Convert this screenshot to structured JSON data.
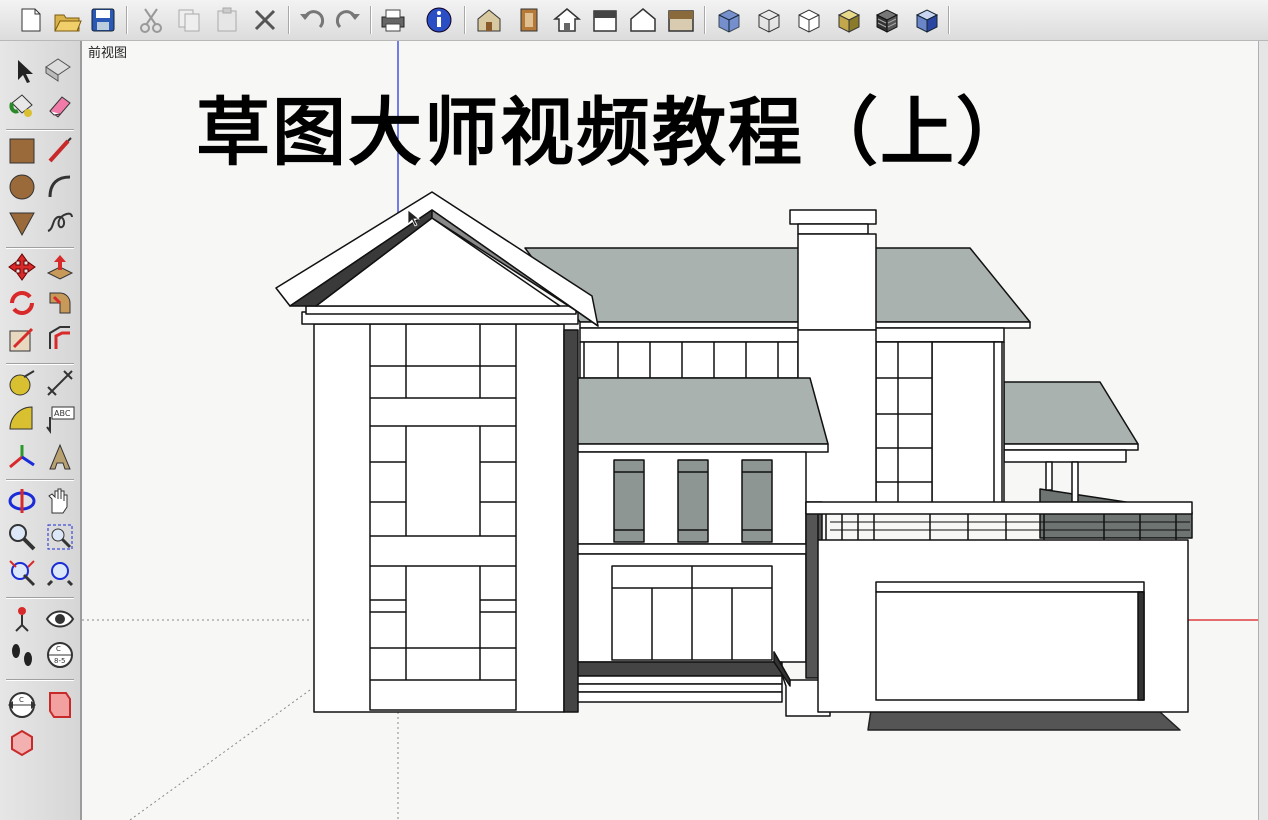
{
  "toolbar": {
    "icons": [
      "new-file-icon",
      "open-file-icon",
      "save-icon",
      "cut-icon",
      "copy-icon",
      "paste-icon",
      "erase-selection-icon",
      "undo-icon",
      "redo-icon",
      "print-icon",
      "model-info-icon",
      "iso-view-icon",
      "top-view-icon",
      "front-view-icon",
      "right-view-icon",
      "back-view-icon",
      "left-view-icon",
      "xray-style-icon",
      "wireframe-style-icon",
      "hidden-line-style-icon",
      "shaded-style-icon",
      "shaded-textures-style-icon",
      "monochrome-style-icon"
    ]
  },
  "sidebar": {
    "tools": [
      "select-tool",
      "make-component-tool",
      "paint-bucket-tool",
      "eraser-tool",
      "rectangle-tool",
      "line-tool",
      "circle-tool",
      "arc-tool",
      "polygon-tool",
      "freehand-tool",
      "move-tool",
      "push-pull-tool",
      "rotate-tool",
      "follow-me-tool",
      "scale-tool",
      "offset-tool",
      "tape-measure-tool",
      "dimension-tool",
      "protractor-tool",
      "text-tool",
      "axes-tool",
      "3d-text-tool",
      "orbit-tool",
      "pan-tool",
      "zoom-tool",
      "zoom-window-tool",
      "zoom-extents-tool",
      "previous-view-tool",
      "position-camera-tool",
      "look-around-tool",
      "walk-tool",
      "section-plane-tool",
      "section-display-tool",
      "section-cut-tool",
      "component-tool"
    ]
  },
  "viewport": {
    "view_name": "前视图",
    "overlay_title": "草图大师视频教程（上）"
  },
  "colors": {
    "roof": "#a9b2ae",
    "glass": "#8e9693",
    "wall": "#ffffff",
    "axis_blue": "#1a2bd8",
    "axis_red": "#d81a1a",
    "axis_green": "#2a9a2a",
    "line": "#111111"
  }
}
